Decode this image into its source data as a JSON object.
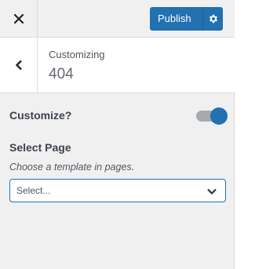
{
  "header": {
    "close_icon": "close-icon",
    "publish_label": "Publish",
    "publish_settings_icon": "gear-icon"
  },
  "section": {
    "back_icon": "chevron-left-icon",
    "breadcrumb": "Customizing",
    "title": "404"
  },
  "controls": {
    "customize_label": "Customize?",
    "customize_enabled": true,
    "select_page_label": "Select Page",
    "select_page_description": "Choose a template in pages.",
    "select_page_value": "Select..."
  },
  "colors": {
    "accent": "#2271b1",
    "panel_bg": "#f0f0f1",
    "border": "#dcdcde"
  }
}
